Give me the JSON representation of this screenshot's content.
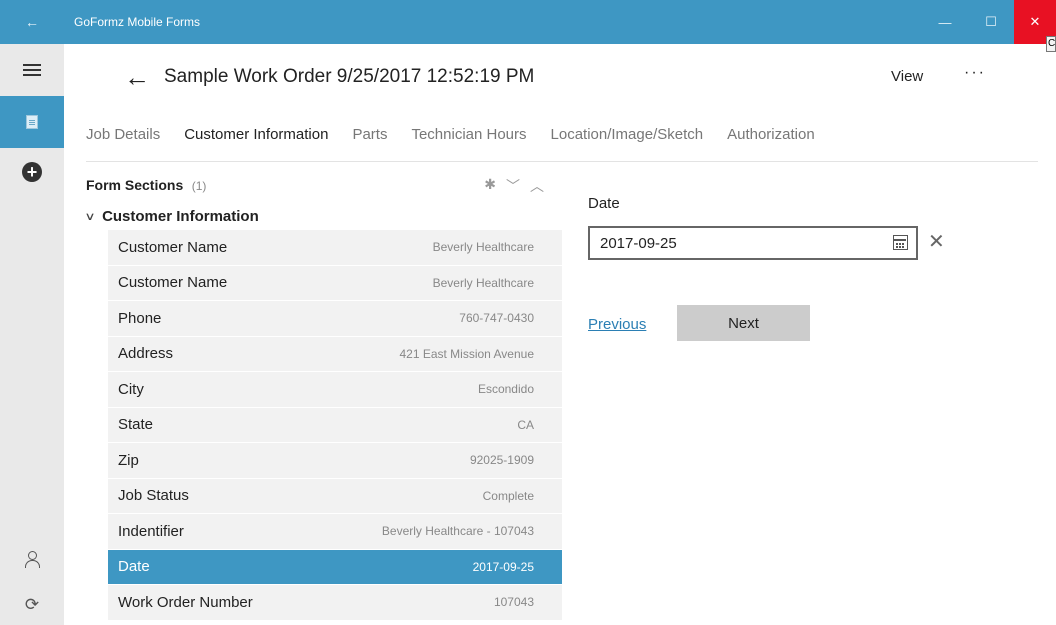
{
  "window": {
    "back_glyph": "←",
    "title": "GoFormz Mobile Forms",
    "minimize_glyph": "—",
    "maximize_glyph": "☐",
    "close_glyph": "✕",
    "tooltip_text": "C"
  },
  "rail": {
    "menu_icon": "hamburger-icon",
    "forms_icon": "document-icon",
    "add_icon": "plus-circle-icon",
    "add_glyph": "+",
    "user_icon": "user-icon",
    "sync_icon": "sync-icon",
    "sync_glyph": "⟳"
  },
  "header": {
    "back_glyph": "←",
    "title": "Sample Work Order 9/25/2017 12:52:19 PM",
    "view_label": "View",
    "more_glyph": "···"
  },
  "tabs": [
    {
      "label": "Job Details",
      "active": false
    },
    {
      "label": "Customer Information",
      "active": true
    },
    {
      "label": "Parts",
      "active": false
    },
    {
      "label": "Technician Hours",
      "active": false
    },
    {
      "label": "Location/Image/Sketch",
      "active": false
    },
    {
      "label": "Authorization",
      "active": false
    }
  ],
  "sections": {
    "title": "Form Sections",
    "count": "(1)",
    "required_glyph": "✱",
    "next_glyph": "﹀",
    "prev_glyph": "︿",
    "group": {
      "chevron_glyph": "∨",
      "label": "Customer Information"
    },
    "rows": [
      {
        "label": "Customer Name",
        "value": "Beverly Healthcare",
        "selected": false
      },
      {
        "label": "Customer Name",
        "value": "Beverly Healthcare",
        "selected": false
      },
      {
        "label": "Phone",
        "value": "760-747-0430",
        "selected": false
      },
      {
        "label": "Address",
        "value": "421 East Mission Avenue",
        "selected": false
      },
      {
        "label": "City",
        "value": "Escondido",
        "selected": false
      },
      {
        "label": "State",
        "value": "CA",
        "selected": false
      },
      {
        "label": "Zip",
        "value": "92025-1909",
        "selected": false
      },
      {
        "label": "Job Status",
        "value": "Complete",
        "selected": false
      },
      {
        "label": "Indentifier",
        "value": "Beverly Healthcare - 107043",
        "selected": false
      },
      {
        "label": "Date",
        "value": "2017-09-25",
        "selected": true
      },
      {
        "label": "Work Order Number",
        "value": "107043",
        "selected": false
      }
    ]
  },
  "detail": {
    "field_label": "Date",
    "field_value": "2017-09-25",
    "calendar_icon": "calendar-icon",
    "clear_glyph": "✕",
    "previous_label": "Previous",
    "next_label": "Next"
  },
  "colors": {
    "accent": "#3e97c3",
    "close_red": "#e81123",
    "row_bg": "#f2f2f2",
    "button_gray": "#cccccc"
  }
}
